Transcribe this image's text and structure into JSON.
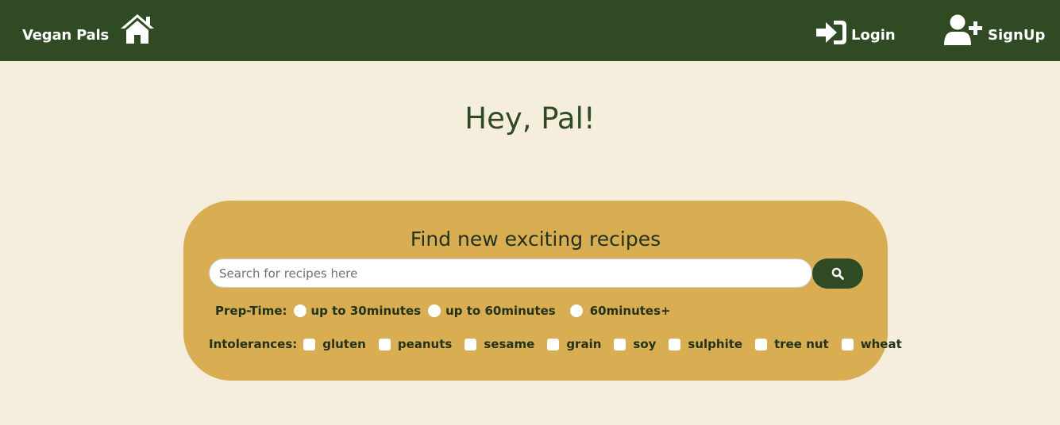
{
  "navbar": {
    "brand": "Vegan Pals",
    "home_icon": "home-icon",
    "login_label": "Login",
    "login_icon": "sign-in-icon",
    "signup_label": "SignUp",
    "signup_icon": "user-plus-icon",
    "background": "#304b24"
  },
  "main": {
    "greeting": "Hey, Pal!",
    "background": "#f5eedd"
  },
  "search": {
    "title": "Find new exciting recipes",
    "placeholder": "Search for recipes here",
    "button_icon": "search-icon",
    "card_color": "#d9ae53"
  },
  "prep_time": {
    "label": "Prep-Time:",
    "options": [
      "up to 30minutes",
      "up to 60minutes",
      "60minutes+"
    ]
  },
  "intolerances": {
    "label": "Intolerances:",
    "options": [
      "gluten",
      "peanuts",
      "sesame",
      "grain",
      "soy",
      "sulphite",
      "tree nut",
      "wheat"
    ]
  }
}
